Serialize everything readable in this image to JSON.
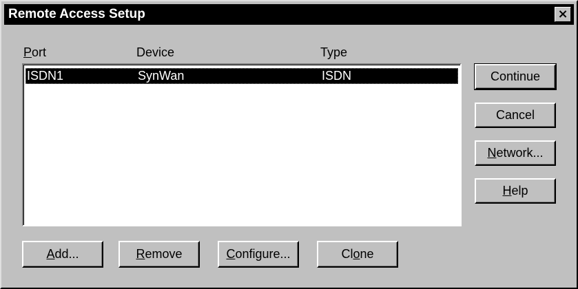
{
  "window": {
    "title": "Remote Access Setup",
    "close_glyph": "×"
  },
  "columns": [
    {
      "label_prefix": "",
      "mnemonic": "P",
      "label_rest": "ort"
    },
    {
      "label": "Device"
    },
    {
      "label": "Type"
    }
  ],
  "rows": [
    {
      "port": "ISDN1",
      "device": "SynWan",
      "type": "ISDN",
      "selected": true
    }
  ],
  "side_buttons": {
    "continue": "Continue",
    "cancel": "Cancel",
    "network": {
      "mnemonic": "N",
      "rest": "etwork..."
    },
    "help": {
      "mnemonic": "H",
      "rest": "elp"
    }
  },
  "bottom_buttons": {
    "add": {
      "mnemonic": "A",
      "rest": "dd..."
    },
    "remove": {
      "mnemonic": "R",
      "rest": "emove"
    },
    "configure": {
      "mnemonic": "C",
      "rest": "onfigure..."
    },
    "clone": {
      "prefix": "Cl",
      "mnemonic": "o",
      "rest": "ne"
    }
  },
  "colors": {
    "face": "#c0c0c0",
    "title_bg": "#000000",
    "selection": "#000000"
  }
}
